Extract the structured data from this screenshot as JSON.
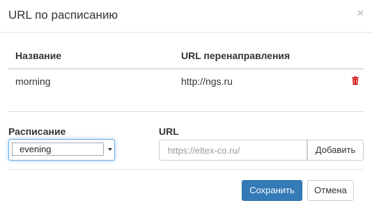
{
  "dialog": {
    "title": "URL по расписанию",
    "close_glyph": "×"
  },
  "table": {
    "headers": [
      "Название",
      "URL перенаправления"
    ],
    "rows": [
      {
        "name": "morning",
        "url": "http://ngs.ru",
        "action_icon": "trash-icon"
      }
    ]
  },
  "form": {
    "schedule_label": "Расписание",
    "schedule_selected": "evening",
    "url_label": "URL",
    "url_value": "",
    "url_placeholder": "https://eltex-co.ru/",
    "add_label": "Добавить"
  },
  "footer": {
    "save_label": "Сохранить",
    "cancel_label": "Отмена"
  },
  "colors": {
    "primary": "#337ab7",
    "danger": "#cc0000",
    "focus": "#66afe9"
  }
}
